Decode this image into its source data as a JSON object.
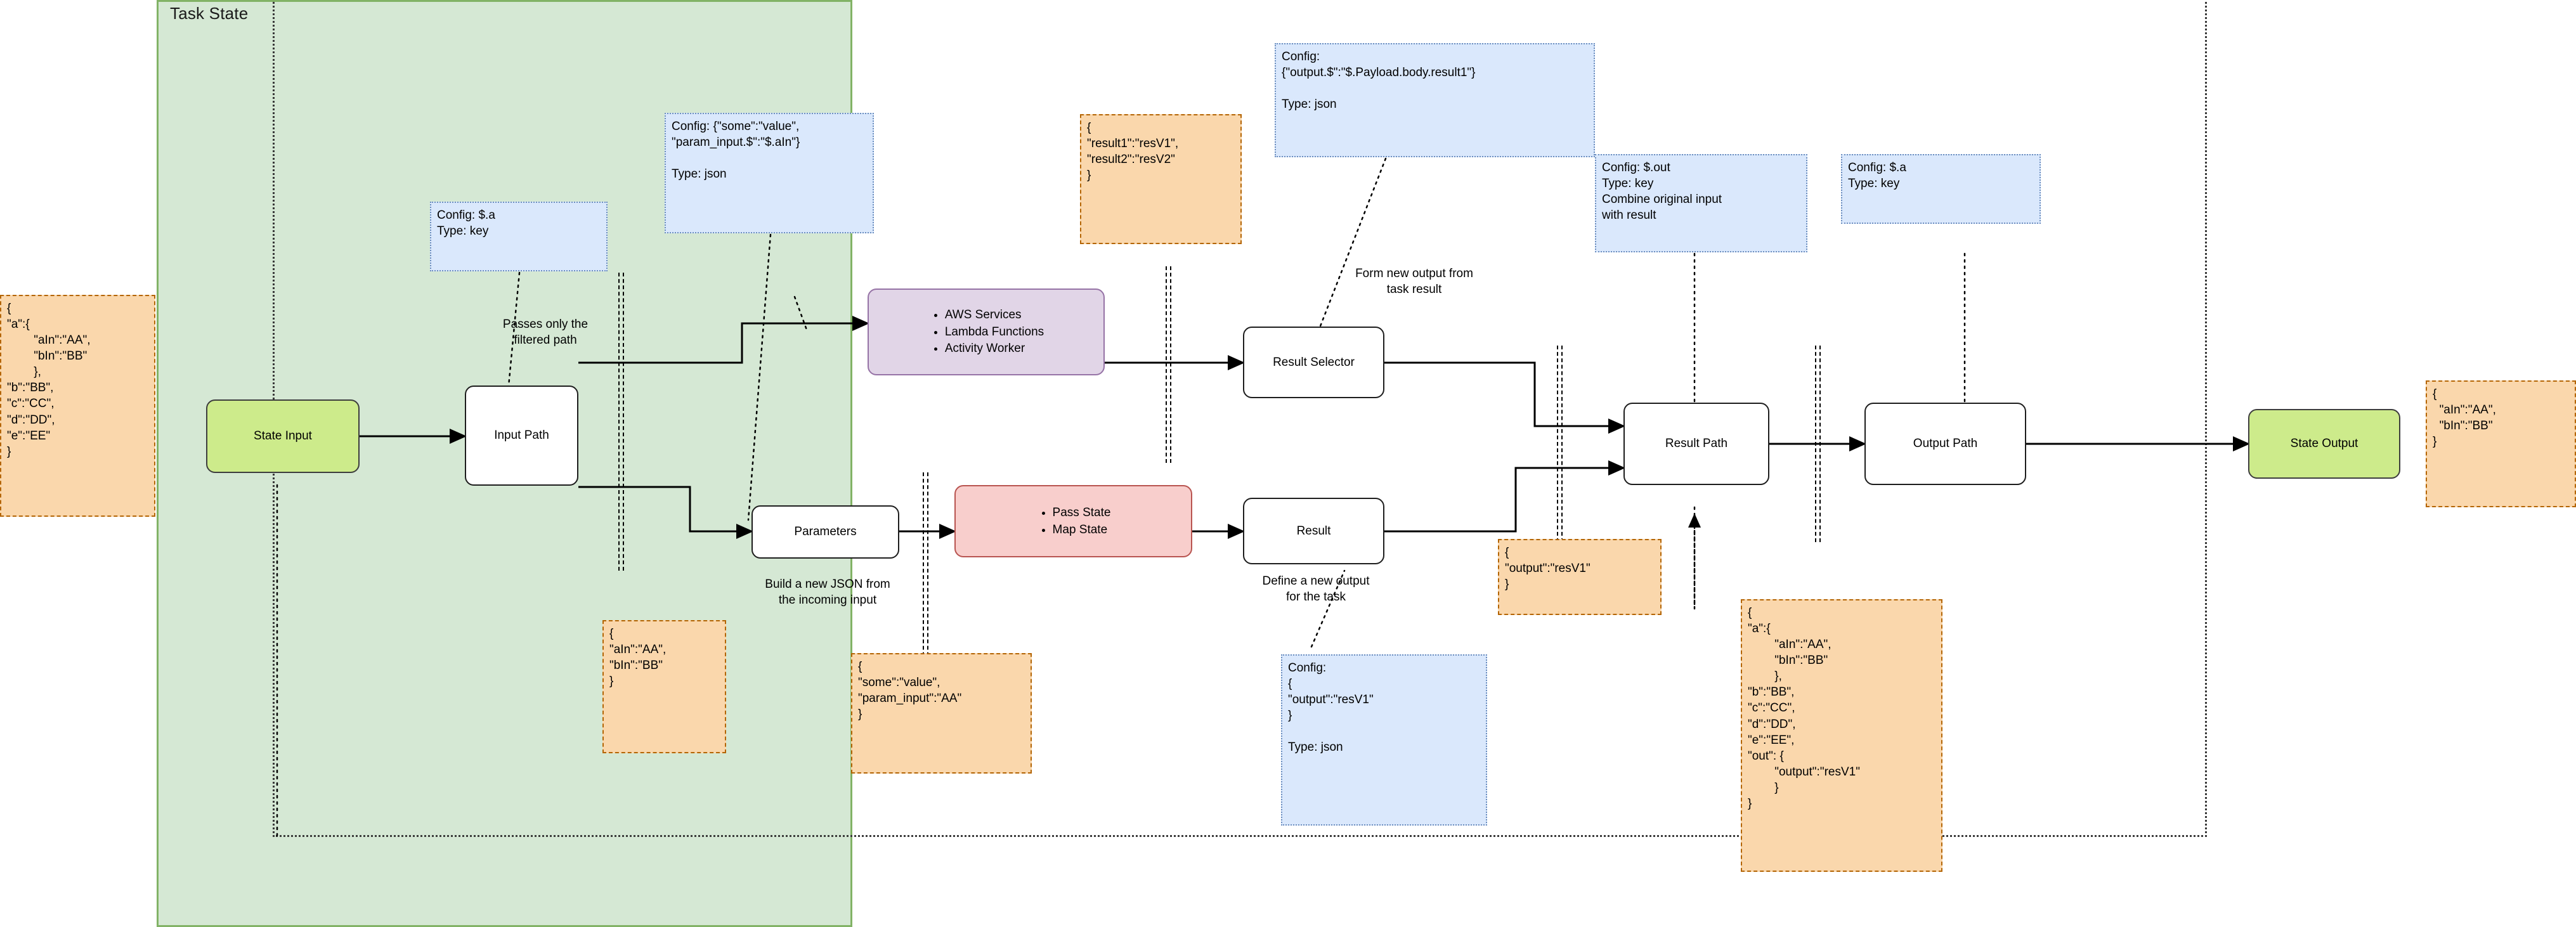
{
  "panel": {
    "title": "Task State"
  },
  "nodes": {
    "state_input": "State Input",
    "input_path": "Input Path",
    "parameters": "Parameters",
    "result_selector": "Result Selector",
    "result": "Result",
    "result_path": "Result Path",
    "output_path": "Output Path",
    "state_output": "State Output",
    "task_resources": [
      "AWS Services",
      "Lambda Functions",
      "Activity Worker"
    ],
    "pass_map_states": [
      "Pass State",
      "Map State"
    ]
  },
  "labels": {
    "passes_filtered": "Passes only the\nfiltered path",
    "build_new_json": "Build a new JSON from\nthe incoming input",
    "form_new_output": "Form new output from\ntask result",
    "define_new_output": "Define a new output\nfor the task"
  },
  "config_notes": {
    "input_path": "Config: $.a\nType: key",
    "parameters": "Config: {\"some\":\"value\",\n\"param_input.$\":\"$.aIn\"}\n\nType: json",
    "result_selector": "Config:\n{\"output.$\":\"$.Payload.body.result1\"}\n\nType: json",
    "result_path": "Config: $.out\nType: key\nCombine original input\nwith result",
    "output_path": "Config: $.a\nType: key",
    "result": "Config:\n{\n\"output\":\"resV1\"\n}\n\nType: json"
  },
  "data_notes": {
    "state_input": "{\n\"a\":{\n        \"aIn\":\"AA\",\n        \"bIn\":\"BB\"\n        },\n\"b\":\"BB\",\n\"c\":\"CC\",\n\"d\":\"DD\",\n\"e\":\"EE\"\n}",
    "after_input_path": "{\n\"aIn\":\"AA\",\n\"bIn\":\"BB\"\n}",
    "after_parameters": "{\n\"some\":\"value\",\n\"param_input\":\"AA\"\n}",
    "task_result": "{\n\"result1\":\"resV1\",\n\"result2\":\"resV2\"\n}",
    "after_result_selector": "{\n\"output\":\"resV1\"\n}",
    "after_result_path": "{\n\"a\":{\n        \"aIn\":\"AA\",\n        \"bIn\":\"BB\"\n        },\n\"b\":\"BB\",\n\"c\":\"CC\",\n\"d\":\"DD\",\n\"e\":\"EE\",\n\"out\": {\n        \"output\":\"resV1\"\n        }\n}",
    "state_output": "{\n  \"aIn\":\"AA\",\n  \"bIn\":\"BB\"\n}"
  },
  "colors": {
    "panel_fill": "#d5e8d4",
    "panel_border": "#82b366",
    "green_node": "#cdeb8b",
    "purple_node": "#e1d5e7",
    "purple_border": "#9673a6",
    "pink_node": "#f8cecc",
    "pink_border": "#b85450",
    "note_blue": "#dae8fc",
    "note_blue_border": "#6c8ebf",
    "note_orange": "#fad7ac",
    "note_orange_border": "#b46504"
  }
}
